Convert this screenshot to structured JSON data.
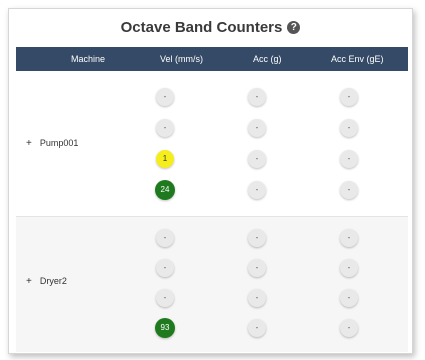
{
  "widget": {
    "title": "Octave Band Counters",
    "help_icon": "?"
  },
  "columns": [
    "Machine",
    "Vel (mm/s)",
    "Acc (g)",
    "Acc Env (gE)"
  ],
  "rows": [
    {
      "machine": "Pump001",
      "expand": "+",
      "vel": [
        "-",
        "-",
        "1",
        "24"
      ],
      "acc": [
        "-",
        "-",
        "-",
        "-"
      ],
      "env": [
        "-",
        "-",
        "-",
        "-"
      ]
    },
    {
      "machine": "Dryer2",
      "expand": "+",
      "vel": [
        "-",
        "-",
        "-",
        "93"
      ],
      "acc": [
        "-",
        "-",
        "-",
        "-"
      ],
      "env": [
        "-",
        "-",
        "-",
        "-"
      ]
    }
  ],
  "colors": {
    "header_bg": "#354a66",
    "yellow": "#f6ee1c",
    "green": "#1f7a1f",
    "neutral": "#e9e9e9"
  }
}
